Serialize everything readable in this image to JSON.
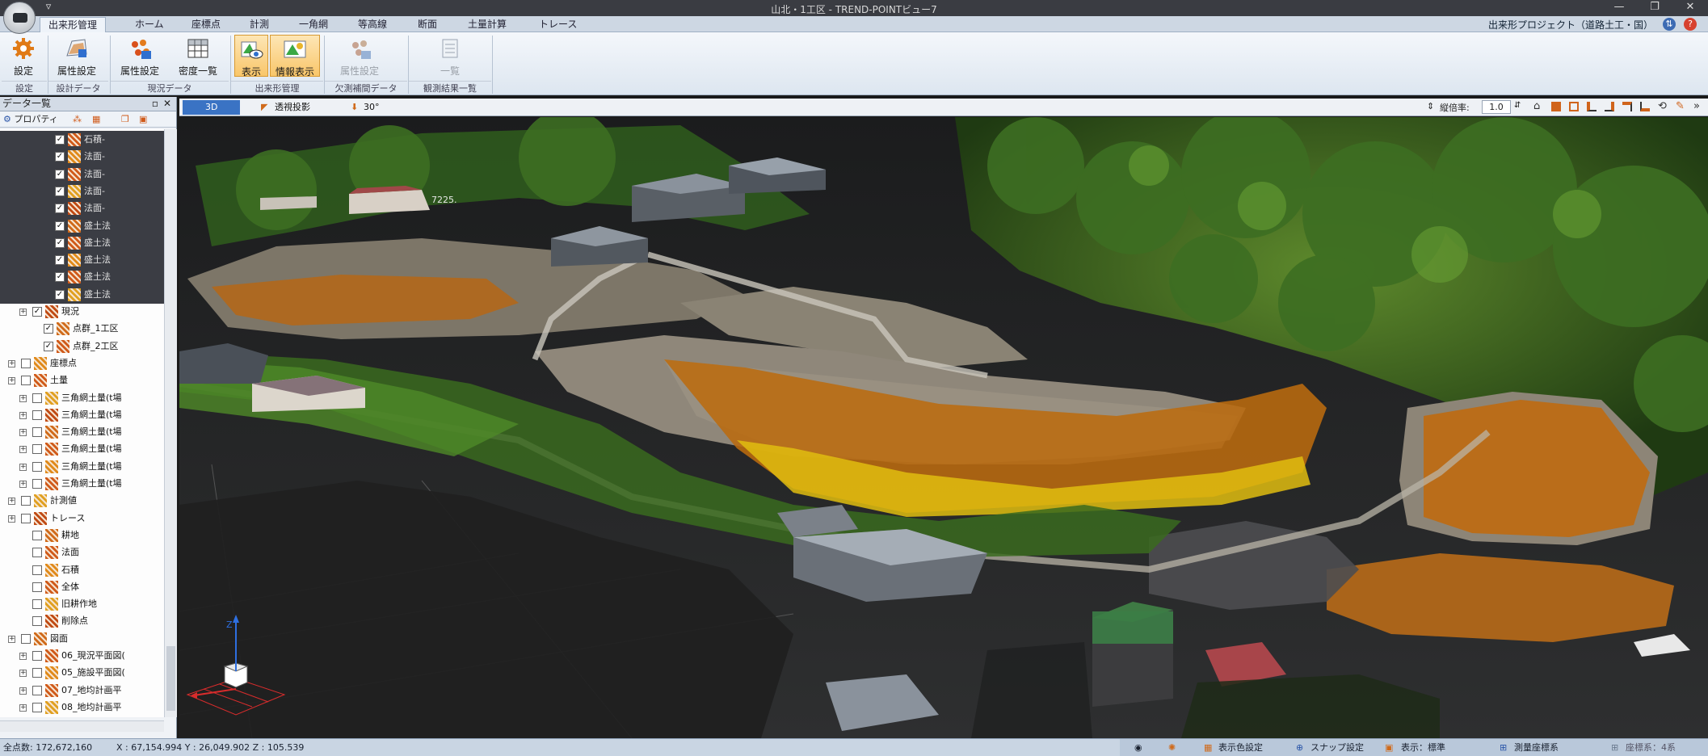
{
  "window": {
    "title": "山北・1工区 - TREND-POINTビュー7"
  },
  "tabs": [
    {
      "label": "出来形管理",
      "active": true
    },
    {
      "label": "ホーム"
    },
    {
      "label": "座標点"
    },
    {
      "label": "計測"
    },
    {
      "label": "一角網"
    },
    {
      "label": "等高線"
    },
    {
      "label": "断面"
    },
    {
      "label": "土量計算"
    },
    {
      "label": "トレース"
    }
  ],
  "project": "出来形プロジェクト（道路土工・国）",
  "ribbon": {
    "buttons": {
      "settings": "設定",
      "attr_settings_1": "属性設定",
      "attr_settings_2": "属性設定",
      "density_list": "密度一覧",
      "display": "表示",
      "info_display": "情報表示",
      "attr_settings_3": "属性設定",
      "list": "一覧"
    },
    "groups": {
      "settings": "設定",
      "design_data": "設計データ",
      "current_data": "現況データ",
      "as_built": "出来形管理",
      "gap_data": "欠測補間データ",
      "obs_results": "観測結果一覧"
    }
  },
  "panel": {
    "title": "データ一覧",
    "tool_property": "プロパティ"
  },
  "tree": [
    {
      "label": "石積-",
      "checked": true,
      "dark": true
    },
    {
      "label": "法面-",
      "checked": true,
      "dark": true
    },
    {
      "label": "法面-",
      "checked": true,
      "dark": true
    },
    {
      "label": "法面-",
      "checked": true,
      "dark": true
    },
    {
      "label": "法面-",
      "checked": true,
      "dark": true
    },
    {
      "label": "盛土法",
      "checked": true,
      "dark": true
    },
    {
      "label": "盛土法",
      "checked": true,
      "dark": true
    },
    {
      "label": "盛土法",
      "checked": true,
      "dark": true
    },
    {
      "label": "盛土法",
      "checked": true,
      "dark": true
    },
    {
      "label": "盛土法",
      "checked": true,
      "dark": true
    },
    {
      "label": "現況",
      "checked": true
    },
    {
      "label": "点群_1工区",
      "checked": true
    },
    {
      "label": "点群_2工区",
      "checked": true
    },
    {
      "label": "座標点",
      "checked": false
    },
    {
      "label": "土量",
      "checked": false
    },
    {
      "label": "三角網土量(t場",
      "checked": false
    },
    {
      "label": "三角網土量(t場",
      "checked": false
    },
    {
      "label": "三角網土量(t場",
      "checked": false
    },
    {
      "label": "三角網土量(t場",
      "checked": false
    },
    {
      "label": "三角網土量(t場",
      "checked": false
    },
    {
      "label": "三角網土量(t場",
      "checked": false
    },
    {
      "label": "計測値",
      "checked": false
    },
    {
      "label": "トレース",
      "checked": false
    },
    {
      "label": "耕地",
      "checked": false
    },
    {
      "label": "法面",
      "checked": false
    },
    {
      "label": "石積",
      "checked": false
    },
    {
      "label": "全体",
      "checked": false
    },
    {
      "label": "旧耕作地",
      "checked": false
    },
    {
      "label": "削除点",
      "checked": false
    },
    {
      "label": "図面",
      "checked": false
    },
    {
      "label": "06_現況平面図(",
      "checked": false
    },
    {
      "label": "05_施設平面図(",
      "checked": false
    },
    {
      "label": "07_地均計画平",
      "checked": false
    },
    {
      "label": "08_地均計画平",
      "checked": false
    }
  ],
  "view_toolbar": {
    "mode_3d": "3D",
    "perspective": "透視投影",
    "angle": "30°",
    "vscale_label": "縦倍率:",
    "vscale_value": "1.0"
  },
  "viewport": {
    "measure_label": "7225."
  },
  "status": {
    "total_points": "全点数: 172,672,160",
    "coords": "X : 67,154.994  Y : 26,049.902  Z : 105.539",
    "color_settings": "表示色設定",
    "snap_settings": "スナップ設定",
    "display_mode": "表示：標準",
    "survey_coords": "測量座標系",
    "coord_system": "座標系：4系"
  },
  "colors": {
    "accent": "#3a73c4",
    "ribbon_selected": "#f9c66a",
    "design_surface": "#c86d14",
    "design_edge": "#e8c40c"
  }
}
